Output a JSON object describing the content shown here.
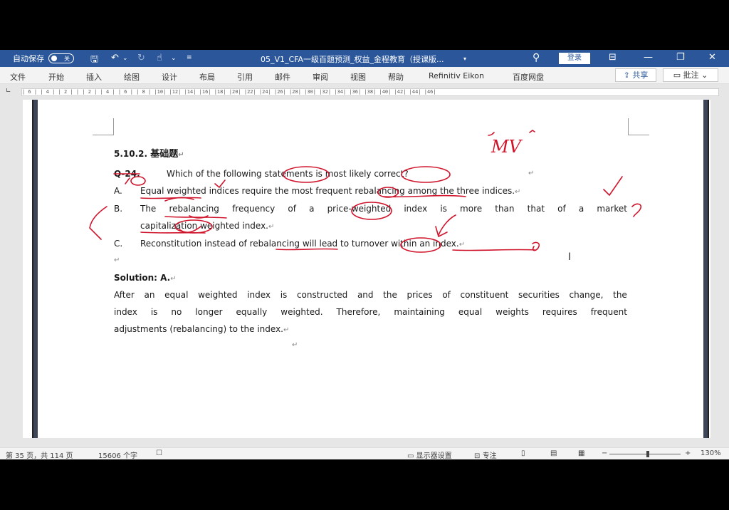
{
  "titlebar": {
    "autosave_label": "自动保存",
    "autosave_state": "关",
    "doc_title": "05_V1_CFA一级百题预测_权益_金程教育（授课版...",
    "login": "登录"
  },
  "menu": {
    "items": [
      "文件",
      "开始",
      "插入",
      "绘图",
      "设计",
      "布局",
      "引用",
      "邮件",
      "审阅",
      "视图",
      "帮助",
      "Refinitiv Eikon",
      "百度网盘"
    ],
    "share": "共享",
    "comment": "批注"
  },
  "ruler": {
    "text": "| 6 |  | 4 |  | 2 |  |   | 2 |  | 4 |  | 6 |  | 8 |  |10|  |12|  |14|  |16|  |18|  |20|  |22|  |24|  |26|  |28|  |30|  |32|  |34|  |36|  |38|  |40|  |42|  |44|  |46|"
  },
  "document": {
    "section": "5.10.2.",
    "section_title": "基础题",
    "question_id": "Q-24.",
    "question": "Which of the following statements is most likely correct?",
    "options": [
      {
        "letter": "A.",
        "text": "Equal weighted indices require the most frequent rebalancing among the three indices."
      },
      {
        "letter": "B.",
        "text_line1_words": [
          "The",
          "rebalancing",
          "frequency",
          "of",
          "a",
          "price-weighted",
          "index",
          "is",
          "more",
          "than",
          "that",
          "of",
          "a",
          "market"
        ],
        "text_line2": "capitalization weighted index."
      },
      {
        "letter": "C.",
        "text": "Reconstitution instead of rebalancing will lead to turnover within an index."
      }
    ],
    "solution_label": "Solution: A.",
    "solution_line1_words": [
      "After",
      "an",
      "equal",
      "weighted",
      "index",
      "is",
      "constructed",
      "and",
      "the",
      "prices",
      "of",
      "constituent",
      "securities",
      "change,",
      "the"
    ],
    "solution_line2_words": [
      "index",
      "is",
      "no",
      "longer",
      "equally",
      "weighted.",
      "Therefore,",
      "maintaining",
      "equal",
      "weights",
      "requires",
      "frequent"
    ],
    "solution_line3": "adjustments (rebalancing) to the index.",
    "paragraph_mark": "↵",
    "handwritten_note": "MV"
  },
  "status": {
    "page": "第 35 页，共 114 页",
    "words": "15606 个字",
    "display_settings": "显示器设置",
    "focus": "专注",
    "zoom": "130%"
  },
  "colors": {
    "title_bar": "#2b579a",
    "annotation": "#d0142c"
  }
}
